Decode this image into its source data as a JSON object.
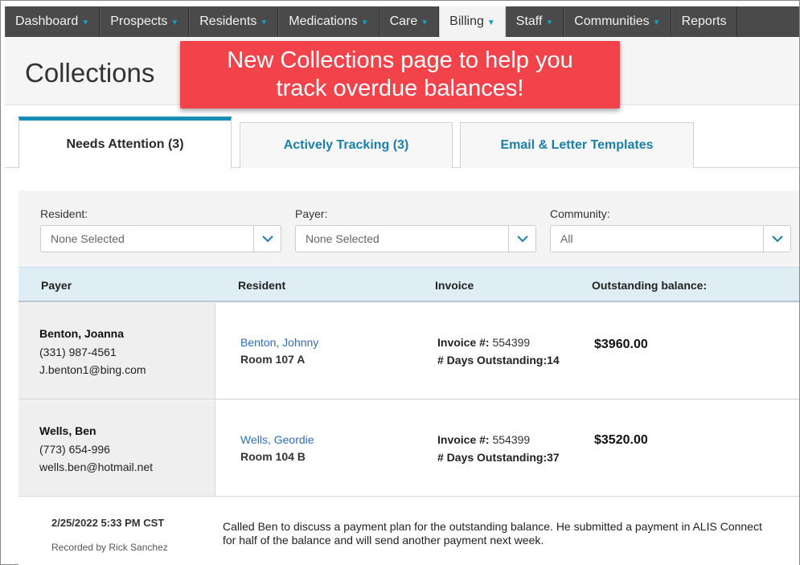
{
  "nav": {
    "items": [
      {
        "label": "Dashboard",
        "dropdown": true
      },
      {
        "label": "Prospects",
        "dropdown": true
      },
      {
        "label": "Residents",
        "dropdown": true
      },
      {
        "label": "Medications",
        "dropdown": true
      },
      {
        "label": "Care",
        "dropdown": true
      },
      {
        "label": "Billing",
        "dropdown": true,
        "active": true
      },
      {
        "label": "Staff",
        "dropdown": true
      },
      {
        "label": "Communities",
        "dropdown": true
      },
      {
        "label": "Reports",
        "dropdown": false
      }
    ]
  },
  "page": {
    "title": "Collections",
    "banner_line1": "New Collections page to help you",
    "banner_line2": "track overdue balances!"
  },
  "tabs": [
    {
      "label": "Needs Attention (3)",
      "active": true
    },
    {
      "label": "Actively Tracking (3)",
      "active": false
    },
    {
      "label": "Email & Letter Templates",
      "active": false
    }
  ],
  "filters": {
    "resident": {
      "label": "Resident:",
      "value": "None Selected"
    },
    "payer": {
      "label": "Payer:",
      "value": "None Selected"
    },
    "community": {
      "label": "Community:",
      "value": "All"
    }
  },
  "table": {
    "headers": {
      "payer": "Payer",
      "resident": "Resident",
      "invoice": "Invoice",
      "balance": "Outstanding balance:"
    },
    "rows": [
      {
        "payer_name": "Benton, Joanna",
        "payer_phone": "(331) 987-4561",
        "payer_email": "J.benton1@bing.com",
        "resident_name": "Benton, Johnny",
        "resident_room": "Room 107 A",
        "invoice_label": "Invoice #:",
        "invoice_number": "554399",
        "days_label": "# Days Outstanding:",
        "days": "14",
        "balance": "$3960.00"
      },
      {
        "payer_name": "Wells, Ben",
        "payer_phone": "(773) 654-996",
        "payer_email": "wells.ben@hotmail.net",
        "resident_name": "Wells, Geordie",
        "resident_room": "Room 104 B",
        "invoice_label": "Invoice #:",
        "invoice_number": "554399",
        "days_label": "# Days Outstanding:",
        "days": "37",
        "balance": "$3520.00"
      }
    ]
  },
  "note": {
    "date": "2/25/2022 5:33 PM CST",
    "recorded_by": "Recorded by Rick Sanchez",
    "text": "Called Ben to discuss a payment plan for the outstanding balance. He submitted a payment in ALIS Connect for half of the balance and will send another payment next week."
  },
  "colors": {
    "nav_bg": "#4a4a4a",
    "accent": "#1b8cb5",
    "banner": "#f2434a",
    "link": "#2f6eb5",
    "table_head": "#dfeef5"
  }
}
